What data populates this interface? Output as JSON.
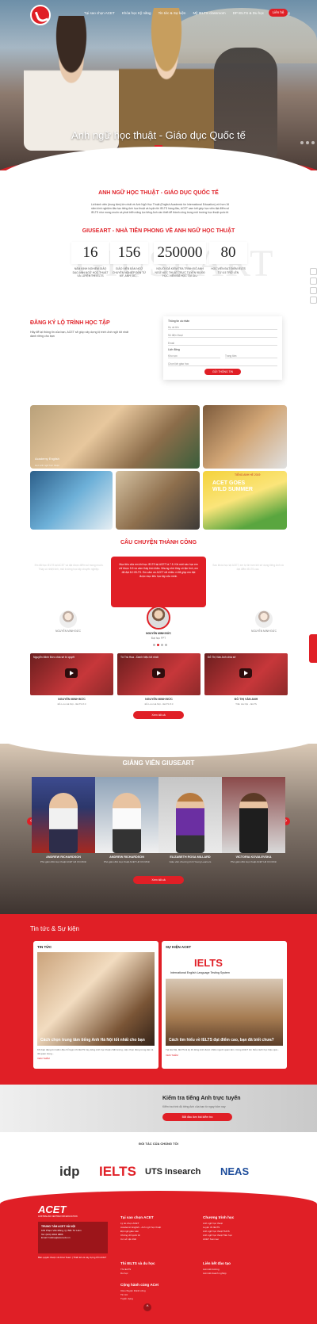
{
  "nav": {
    "items": [
      "Tại sao chọn ACET",
      "Khóa học Kỹ năng",
      "Tin tức & Sự kiện",
      "Mỹ IELTS classroom",
      "DP IELTS & Du học",
      "Tuyển dụng"
    ],
    "contact_label": "Liên hệ"
  },
  "hero": {
    "title": "Anh ngữ học thuật - Giáo dục Quốc tế"
  },
  "intro": {
    "title": "ANH NGỮ HỌC THUẬT - GIÁO DỤC QUỐC TẾ",
    "text": "Là thành viên (trung tâm) lớn nhất về Anh Ngữ Học Thuật (English Academic for International Education) với hơn 16 năm kinh nghiệm đào tạo tiếng Anh học thuật và luyện thi IELTS hàng đầu, ACET cam kết giúp học viên đạt điểm số IELTS như mong muốn và phát triển năng lực tiếng Anh cần thiết để thành công trong môi trường học thuật quốc tế.",
    "subtitle": "GIUSEART - NHÀ TIÊN PHONG VỀ ANH NGỮ HỌC THUẬT",
    "bg_word": "GIUSEART"
  },
  "stats": [
    {
      "number": "16",
      "label": "NĂM KINH NGHIỆM GIẢO DẠO ANH NGỮ HỌC THUẬT VÀ LUYỆN THI IELTS"
    },
    {
      "number": "156",
      "label": "GIẢO VIÊN BẢN NGỮ CHUYÊN NGHIỆP ĐẾN TỪ MỸ, ANH, ÚC,..."
    },
    {
      "number": "250000",
      "label": "NGƯỜI ĐÃ KIỂM TRA TRÌNH ĐỘ ANH NGỮ HỌC THUẬT TRỰC TUYẾN 98.000 HỌC VIÊN ĐÃ HỌC TẠI GIU"
    },
    {
      "number": "80",
      "label": "HỌC VIÊN ĐẠT ĐIỂM IELTS TỪ 6.5 TRỞ LÊN"
    }
  ],
  "register": {
    "title": "ĐĂNG KÝ LỘ TRÌNH HỌC TẬP",
    "desc": "Hãy để lại thông tin của bạn, ACET sẽ giúp xây dựng lộ trình Anh ngữ tốt nhất dành riêng cho bạn",
    "form_label": "Thông tin cá nhân",
    "name_ph": "Họ và tên",
    "phone_ph": "Số điện thoại",
    "email_ph": "Email",
    "schedule_label": "Lịch đăng",
    "area_ph": "Khu vực",
    "center_ph": "Trung tâm",
    "course_ph": "Chọn lịch giao học",
    "submit": "GỬI THÔNG TIN"
  },
  "gallery": [
    {
      "caption": "Academy English",
      "sub": "Học anh ngữ học thuật"
    },
    {
      "caption": "",
      "sub": ""
    },
    {
      "caption": "",
      "sub": ""
    },
    {
      "caption": "",
      "sub": ""
    },
    {
      "caption": "",
      "sub": ""
    }
  ],
  "gallery_extra": {
    "poster_top": "TIẾNG ANH HÈ 2019",
    "poster_main": "ACET GOES WILD SUMMER"
  },
  "stories": {
    "title": "CÂU CHUYỆN THÀNH CÔNG",
    "quote": "Mục tiêu của em khi học IELTS tại ACET là 7.5. Khi mới vào học em chỉ được 5.5 và cảm thấy khó khăn. Nhưng nhờ thầy cô tận tình, em đã đạt 8.0 IELTS. Em cảm ơn ACET rất nhiều vì đã giúp em đạt được mục tiêu học tập của mình.",
    "side_left": "Em đã học IELTS tại ACET và đạt được điểm số mong muốn. Thầy cô nhiệt tình, môi trường học tập chuyên nghiệp.",
    "side_right": "Sau khóa học tại ACET, em tự tin hơn khi sử dụng tiếng Anh và đạt điểm IELTS cao.",
    "people": [
      {
        "name": "NGUYỄN MINH ĐỨC",
        "sub": "Đại học Y"
      },
      {
        "name": "NGUYỄN MINH ĐỨC",
        "sub": "Đại học FPT"
      },
      {
        "name": "NGUYỄN MINH ĐỨC",
        "sub": "THPT Chu Văn An"
      }
    ],
    "videos": [
      {
        "title": "Nguyễn Minh Đức chia sẻ bí quyết",
        "name": "NGUYỄN MINH ĐỨC",
        "sub": "Đỗ Lưu Hà Nội - IELTS 8.0"
      },
      {
        "title": "Tô Trà Hoa - Danh hiệu tốt nhất",
        "name": "NGUYỄN MINH ĐỨC",
        "sub": "Đỗ Lưu Hà Nội - IELTS 8.0"
      },
      {
        "title": "Đỗ Thị Vân Anh chia sẻ",
        "name": "ĐỖ THỊ VÂN ANH",
        "sub": "Trần Hà Nội - IELTS"
      }
    ],
    "more": "Xem tất cả"
  },
  "teachers": {
    "title": "GIẢNG VIÊN GIUSEART",
    "items": [
      {
        "name": "ANDREW RICHARDSON",
        "sub": "Phó giám đốc Học thuật ACET Hồ Chí Minh"
      },
      {
        "name": "ANDREW RICHARDSON",
        "sub": "Phó giám đốc Học thuật ACET Hồ Chí Minh"
      },
      {
        "name": "ELIZABETH ROSA MILLARD",
        "sub": "Giáo viên chương trình Young Learners"
      },
      {
        "name": "VICTORIA KOVALEVSKA",
        "sub": "Phó giám đốc Học thuật ACET Hồ Chí Minh"
      }
    ],
    "more": "Xem tất cả"
  },
  "news": {
    "title": "Tin tức & Sự kiện",
    "cards": [
      {
        "header": "TIN TỨC",
        "caption": "Cách chọn trung tâm tiếng Anh Hà Nội tốt nhất cho bạn",
        "desc": "Khi bạn đang tìm kiếm địa chỉ luyện thi IELTS hay tiếng Anh học thuật chất lượng, việc chọn đúng trung tâm là rất quan trọng...",
        "more": "XEM THÊM"
      },
      {
        "header": "SỰ KIỆN ACET",
        "caption": "Cách tìm hiểu về IELTS đạt điểm cao, bạn đã biết chưa?",
        "desc": "Tại Hà Nội, IELTS là kỳ thi tiếng Anh được nhiều người quan tâm. Cùng ACET tìm hiểu cách học hiệu quả...",
        "more": "XEM THÊM",
        "banner": "IELTS",
        "banner_sub": "International English Language Testing System"
      }
    ]
  },
  "test": {
    "title": "Kiểm tra tiếng Anh trực tuyến",
    "sub": "Kiểm tra trình độ tiếng Anh của bạn từ ngay hôm nay",
    "btn": "Bắt đầu làm bài kiểm tra"
  },
  "partners": {
    "title": "ĐỐI TÁC CỦA CHÚNG TÔI",
    "items": [
      "idp",
      "IELTS",
      "UTS Insearch",
      "NEAS"
    ]
  },
  "footer": {
    "logo": "ACET",
    "logo_sub": "AUSTRALIAN CENTRE FOR EDUCATION",
    "box_title": "TRUNG TÂM ACET HÀ NỘI",
    "box_lines": [
      "109 Phạm Văn Đồng, Q. Bắc Từ Liêm",
      "Tel: (024) 3934 0886",
      "Email: hotline@acet.edu.vn"
    ],
    "copyright": "Bản quyền thuộc về ACet Team | Thiết kế và xây dựng bởi ACET",
    "cols": [
      {
        "title": "Tại sao chọn ACET",
        "items": [
          "Lý do chọn ACET",
          "Academic English - Anh ngữ học thuật",
          "Đội ngũ giáo viên",
          "Chứng chỉ quốc tế",
          "Cơ sở vật chất"
        ]
      },
      {
        "title": "Chương trình học",
        "items": [
          "Anh ngữ học thuật",
          "Luyện thi IELTS",
          "Anh ngữ học thuật THCS",
          "Anh ngữ học thuật Tiểu học",
          "ACET Summer"
        ]
      },
      {
        "title": "Thi IELTS và du học",
        "items": [
          "Thi IELTS",
          "Du học"
        ]
      },
      {
        "title": "Liên kết đào tạo",
        "items": [
          "Liên kết trường",
          "Liên kết doanh nghiệp"
        ]
      },
      {
        "title": "Cộng hành cùng ACet",
        "items": [
          "Câu chuyện thành công",
          "Tin tức",
          "Tuyển dụng"
        ]
      }
    ]
  }
}
